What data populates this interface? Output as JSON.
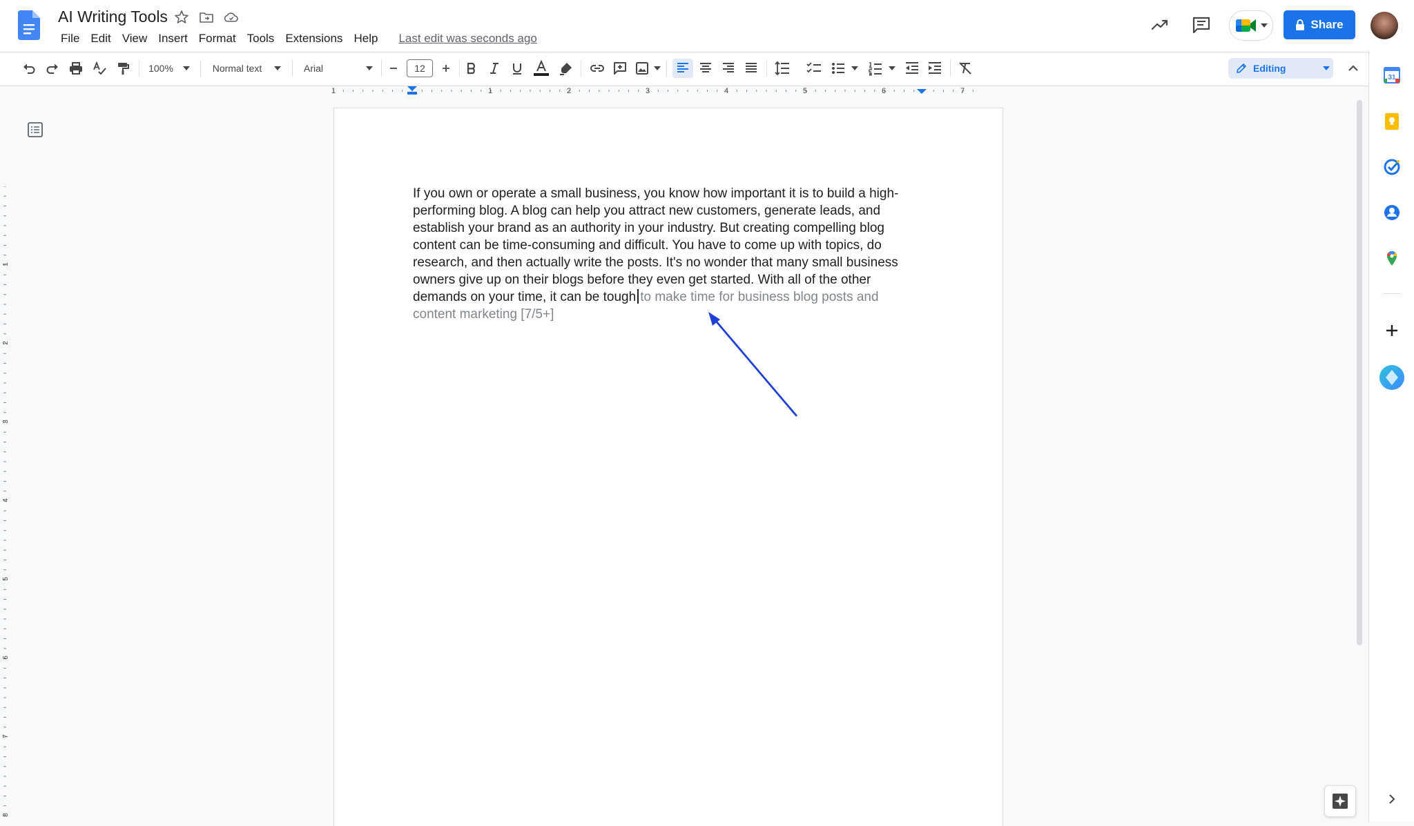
{
  "app": {
    "doc_title": "AI Writing Tools",
    "last_edit": "Last edit was seconds ago"
  },
  "menu": {
    "items": [
      "File",
      "Edit",
      "View",
      "Insert",
      "Format",
      "Tools",
      "Extensions",
      "Help"
    ]
  },
  "header": {
    "share_label": "Share"
  },
  "toolbar": {
    "zoom": "100%",
    "style": "Normal text",
    "font": "Arial",
    "font_size": "12",
    "mode": "Editing"
  },
  "ruler": {
    "numbers": [
      "1",
      "1",
      "2",
      "3",
      "4",
      "5",
      "6",
      "7"
    ]
  },
  "vruler": {
    "numbers": [
      "1",
      "2",
      "3",
      "4",
      "5",
      "6",
      "7",
      "8"
    ]
  },
  "document": {
    "body_text": "If you own or operate a small business, you know how important it is to build a high-performing blog. A blog can help you attract new customers, generate leads, and establish your brand as an authority in your industry. But creating compelling blog content can be time-consuming and difficult. You have to come up with topics, do research, and then actually write the posts. It's no wonder that many small business owners give up on their blogs before they even get started. With all of the other demands on your time, it can be tough",
    "suggestion_text": "to make time for business blog posts and content marketing [7/5+]"
  },
  "colors": {
    "accent": "#1a73e8",
    "annotation_arrow": "#1f3fd6",
    "suggestion_gray": "#80868b"
  },
  "icons": {
    "title": [
      "star-icon",
      "move-folder-icon",
      "cloud-saved-icon"
    ],
    "header": [
      "activity-trend-icon",
      "comment-icon",
      "meet-icon",
      "lock-icon"
    ],
    "side": [
      "calendar-icon",
      "keep-icon",
      "tasks-icon",
      "contacts-icon",
      "maps-icon",
      "add-icon",
      "assistant-icon",
      "chevron-right-icon"
    ]
  }
}
